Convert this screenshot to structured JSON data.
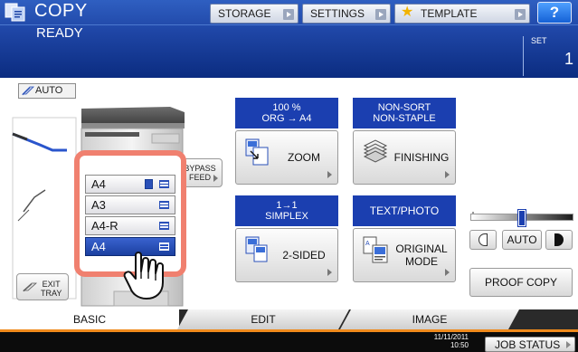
{
  "header": {
    "title": "COPY",
    "status": "READY",
    "buttons": {
      "storage": "STORAGE",
      "settings": "SETTINGS",
      "template": "TEMPLATE",
      "help": "?"
    },
    "set_label": "SET",
    "set_value": "1"
  },
  "auto_badge": "AUTO",
  "bypass": {
    "line1": "BYPASS",
    "line2": "FEED"
  },
  "trays": [
    {
      "label": "A4",
      "selected": false,
      "extra_icon": true
    },
    {
      "label": "A3",
      "selected": false,
      "extra_icon": false
    },
    {
      "label": "A4-R",
      "selected": false,
      "extra_icon": false
    },
    {
      "label": "A4",
      "selected": true,
      "extra_icon": false
    }
  ],
  "exit_tray": {
    "line1": "EXIT",
    "line2": "TRAY"
  },
  "zoom": {
    "pct": "100 %",
    "ratio": "ORG  →  A4",
    "label": "ZOOM"
  },
  "finishing": {
    "line1": "NON-SORT",
    "line2": "NON-STAPLE",
    "label": "FINISHING"
  },
  "duplex": {
    "line1": "1→1",
    "line2": "SIMPLEX",
    "label": "2-SIDED"
  },
  "original": {
    "mode": "TEXT/PHOTO",
    "label_line1": "ORIGINAL",
    "label_line2": "MODE"
  },
  "density": {
    "auto_label": "AUTO",
    "level_fraction": 0.5
  },
  "proof_copy": "PROOF COPY",
  "tabs": {
    "basic": "BASIC",
    "edit": "EDIT",
    "image": "IMAGE"
  },
  "footer": {
    "date": "11/11/2011",
    "time": "10:50",
    "job_status": "JOB STATUS"
  },
  "colors": {
    "accent_blue": "#1b3fb0",
    "highlight": "#f0806f",
    "tab_orange": "#f08a1c"
  }
}
